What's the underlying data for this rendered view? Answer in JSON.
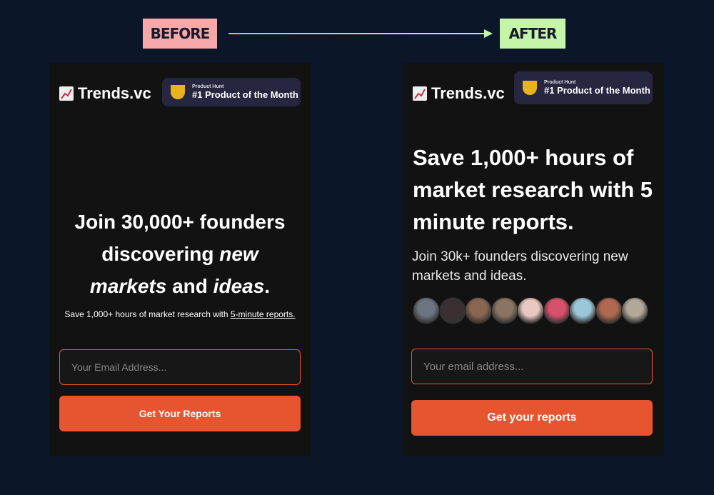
{
  "labels": {
    "before": "BEFORE",
    "after": "AFTER"
  },
  "before": {
    "logo": "Trends.vc",
    "badge": {
      "small": "Product Hunt",
      "big": "#1 Product of the Month"
    },
    "headline": {
      "l1": "Join 30,000+ founders",
      "l2a": "discovering ",
      "l2b": "new",
      "l3a": "markets",
      "l3b": " and ",
      "l3c": "ideas",
      "l3d": "."
    },
    "sub": "Save 1,000+ hours of market research with ",
    "sub_link": "5-minute reports.",
    "email_placeholder": "Your Email Address...",
    "button": "Get Your Reports"
  },
  "after": {
    "logo": "Trends.vc",
    "badge": {
      "small": "Product Hunt",
      "big": "#1 Product of the Month"
    },
    "headline": "Save 1,000+ hours of market research with 5 minute reports.",
    "sub": "Join 30k+ founders discovering new markets and ideas.",
    "avatar_colors": [
      "#6b7480",
      "#3a3030",
      "#8a6650",
      "#8a7560",
      "#e8c8c0",
      "#d8506a",
      "#9ac8d8",
      "#b06850",
      "#b0a898"
    ],
    "email_placeholder": "Your email address...",
    "button": "Get your reports"
  },
  "colors": {
    "accent": "#e6552f",
    "background": "#0b1628",
    "panel": "#121212",
    "before_tag": "#f7a8a8",
    "after_tag": "#c4f5a8"
  }
}
